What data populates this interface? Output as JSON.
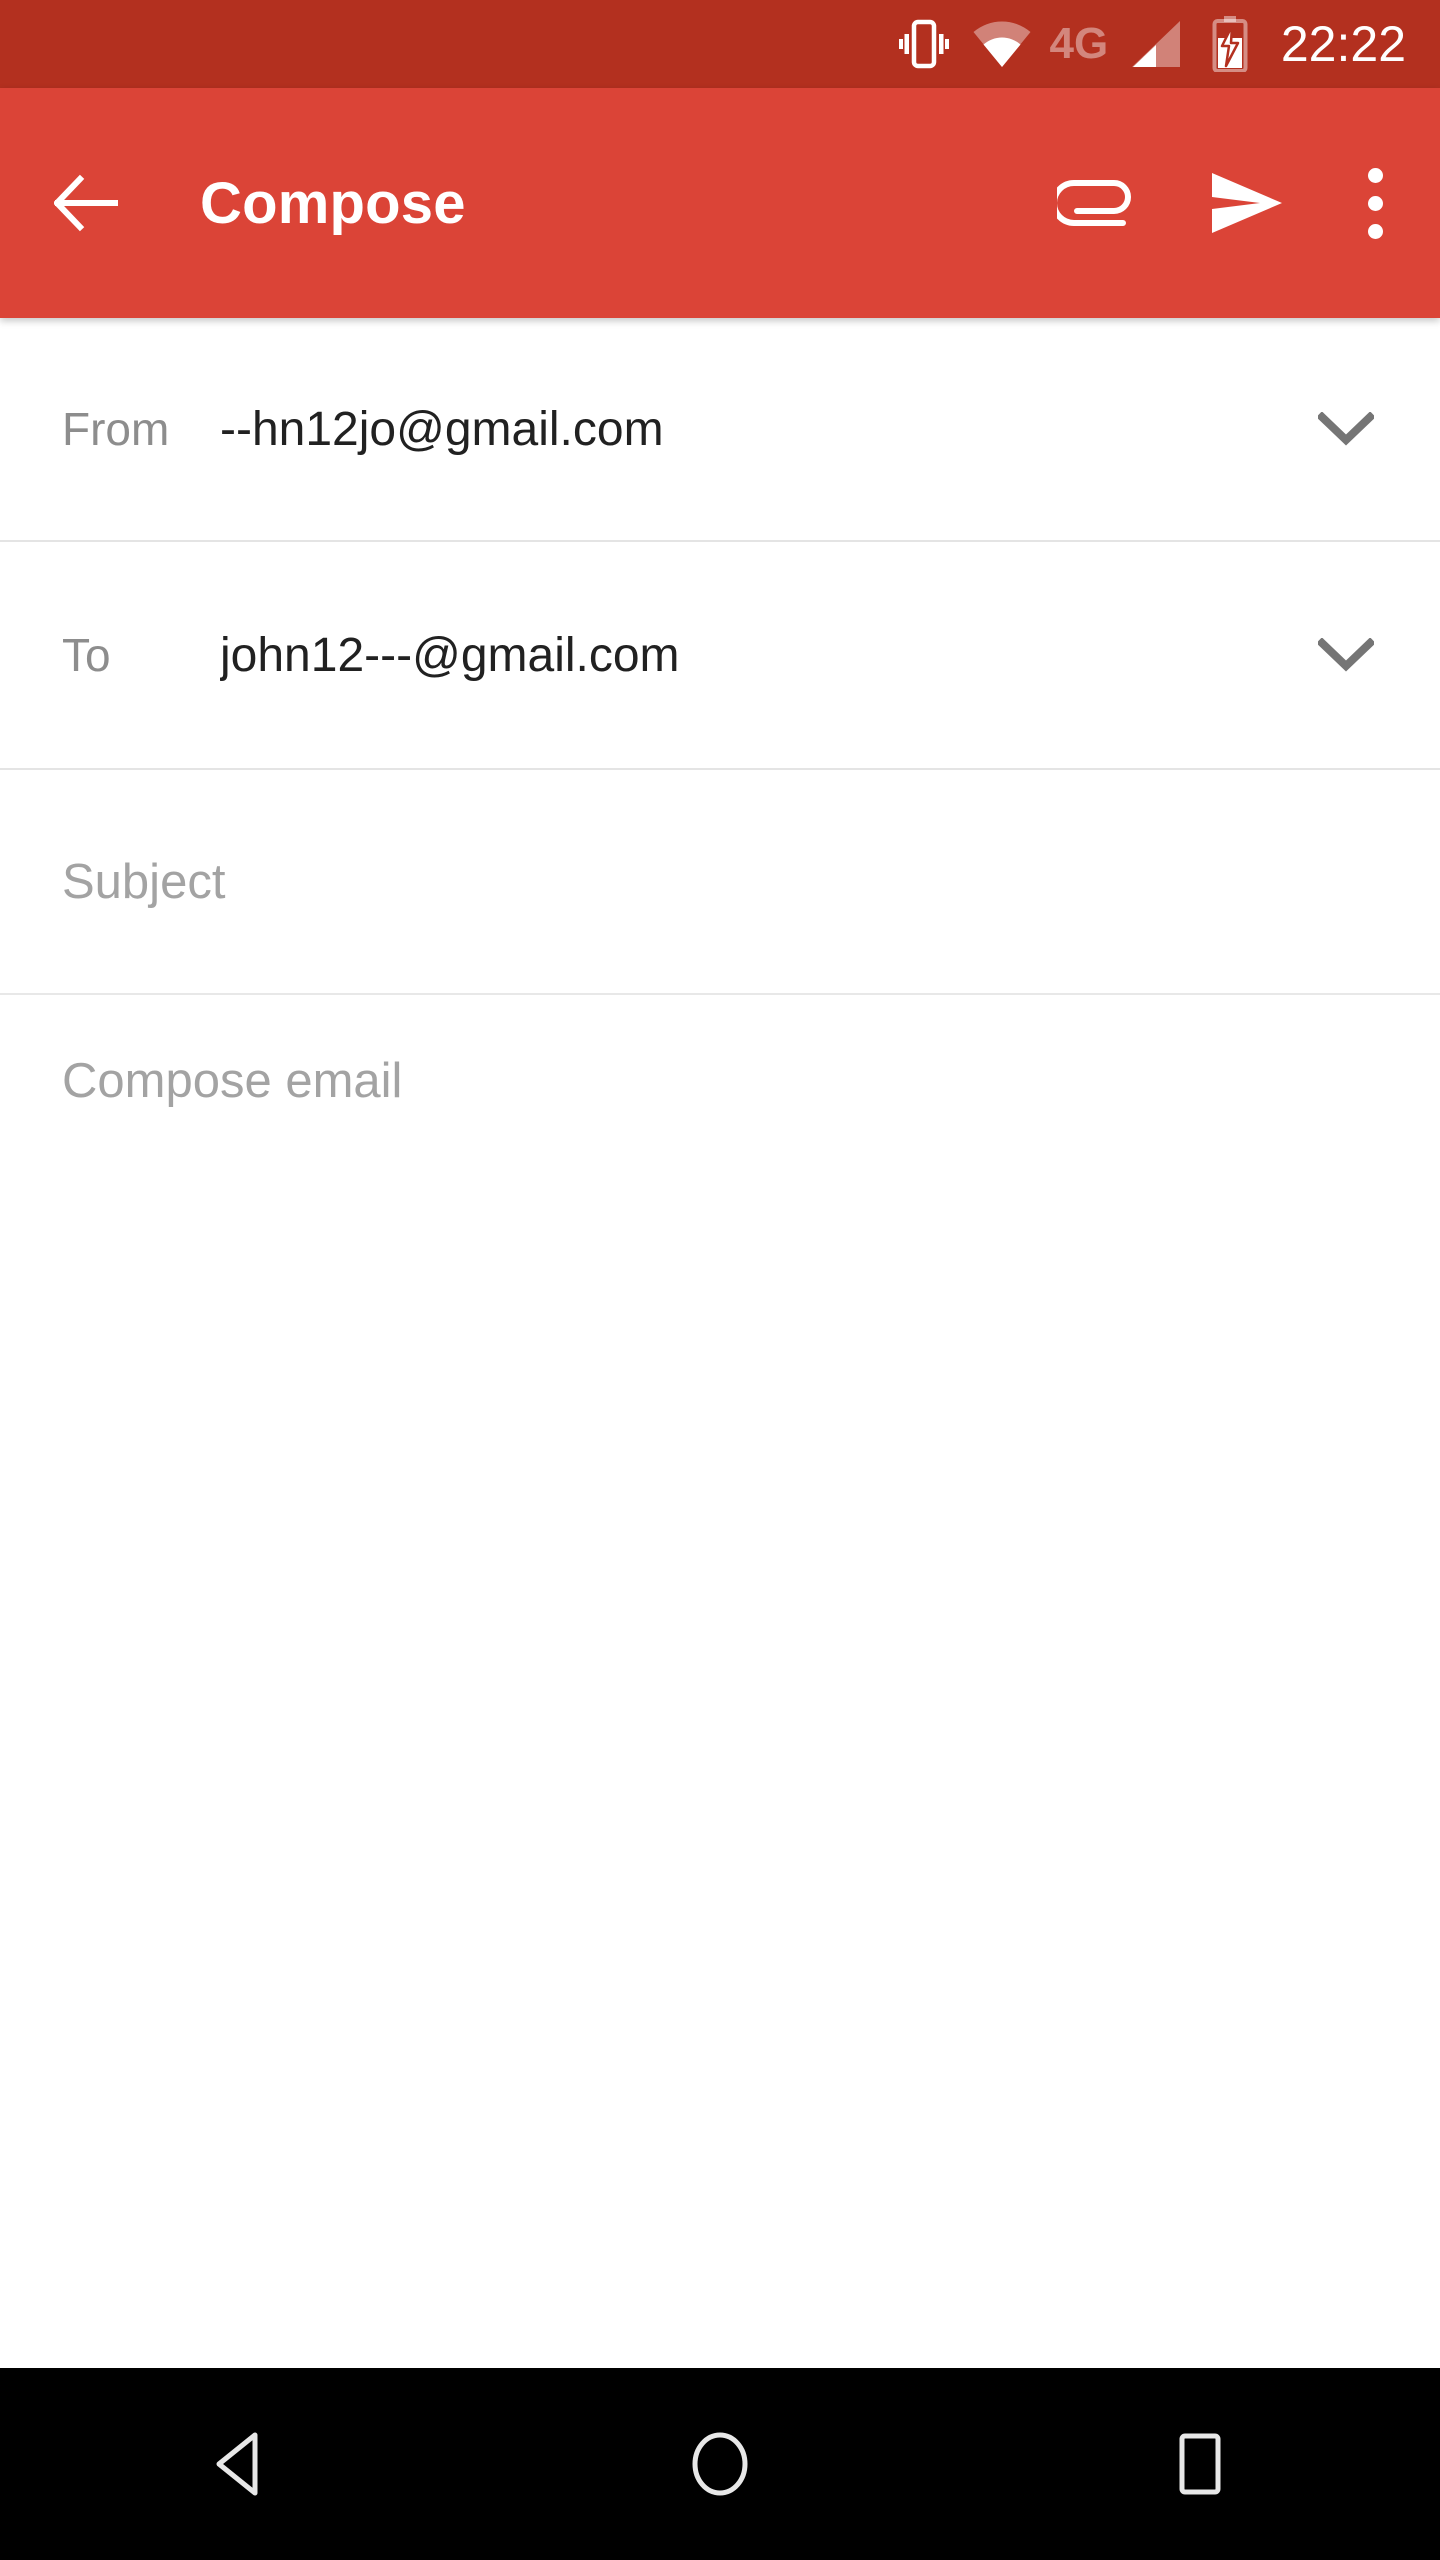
{
  "status_bar": {
    "time": "22:22",
    "network_label": "4G",
    "icons": [
      "vibrate-icon",
      "wifi-icon",
      "network-4g-label",
      "signal-icon",
      "battery-charging-icon"
    ],
    "background_color": "#b3301f"
  },
  "app_bar": {
    "title": "Compose",
    "background_color": "#db4437",
    "back_label": "Back",
    "attach_label": "Attach file",
    "send_label": "Send",
    "more_label": "More options"
  },
  "compose_form": {
    "from": {
      "label": "From",
      "value": "--hn12jo@gmail.com",
      "expander_label": "Show from options"
    },
    "to": {
      "label": "To",
      "value": "john12---@gmail.com",
      "expander_label": "Show cc bcc"
    },
    "subject": {
      "placeholder": "Subject",
      "value": ""
    },
    "body": {
      "placeholder": "Compose email",
      "value": ""
    }
  },
  "nav_bar": {
    "background_color": "#000000",
    "back_label": "Back",
    "home_label": "Home",
    "recents_label": "Recent apps"
  }
}
